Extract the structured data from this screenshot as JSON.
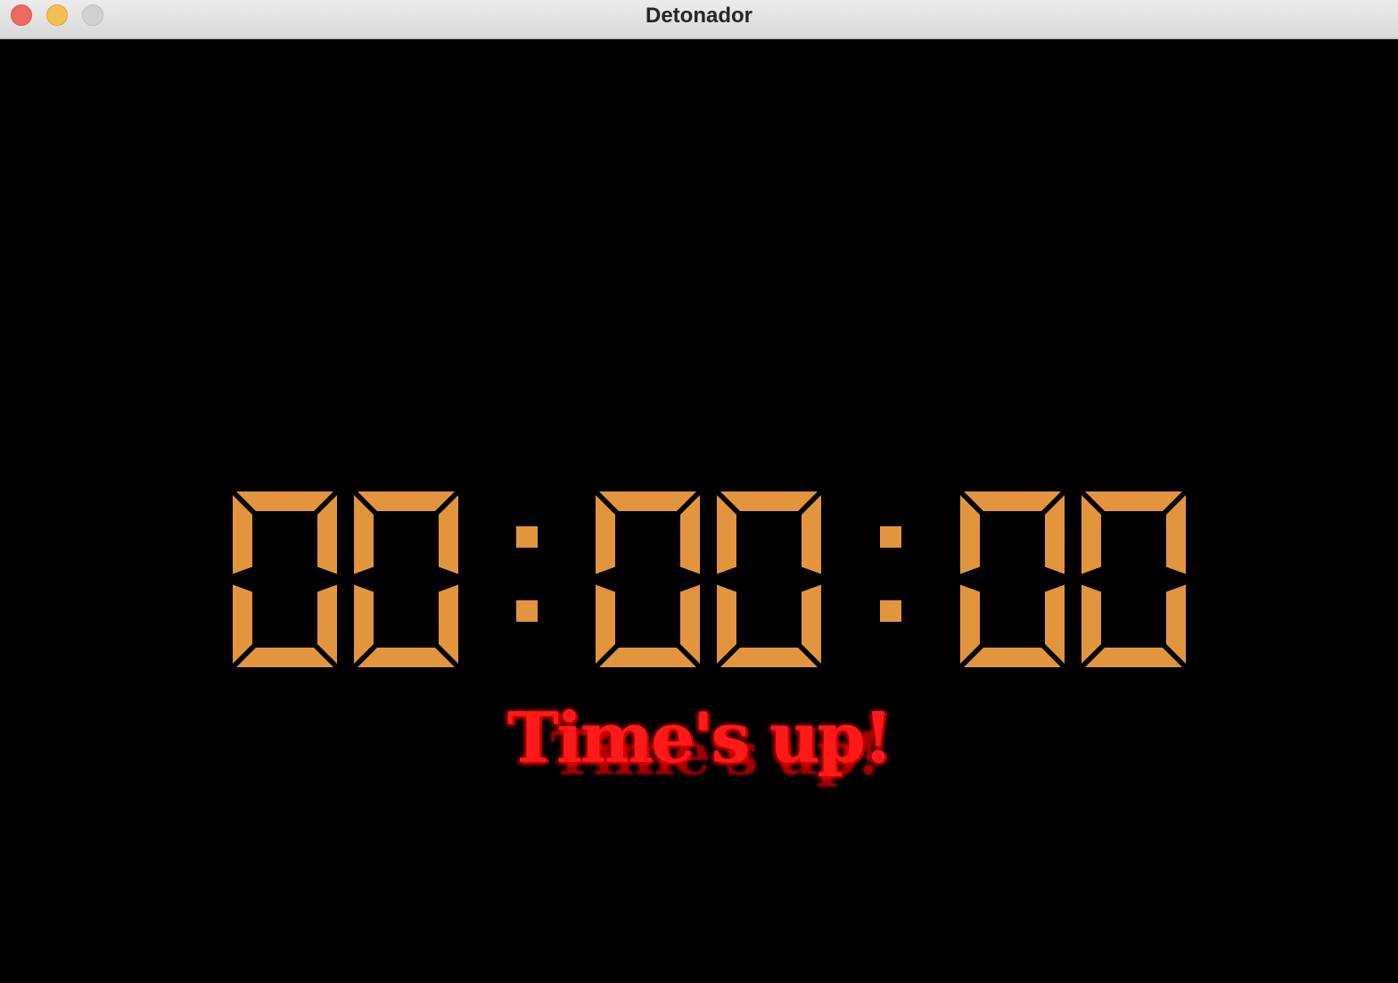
{
  "window": {
    "title": "Detonador",
    "controls": [
      "close",
      "minimize",
      "zoom"
    ]
  },
  "timer": {
    "display": "00:00:00",
    "hours": "00",
    "minutes": "00",
    "seconds": "00",
    "segment_color": "#e3953e"
  },
  "message": {
    "text": "Time's up!",
    "color": "#ff1a1a"
  }
}
